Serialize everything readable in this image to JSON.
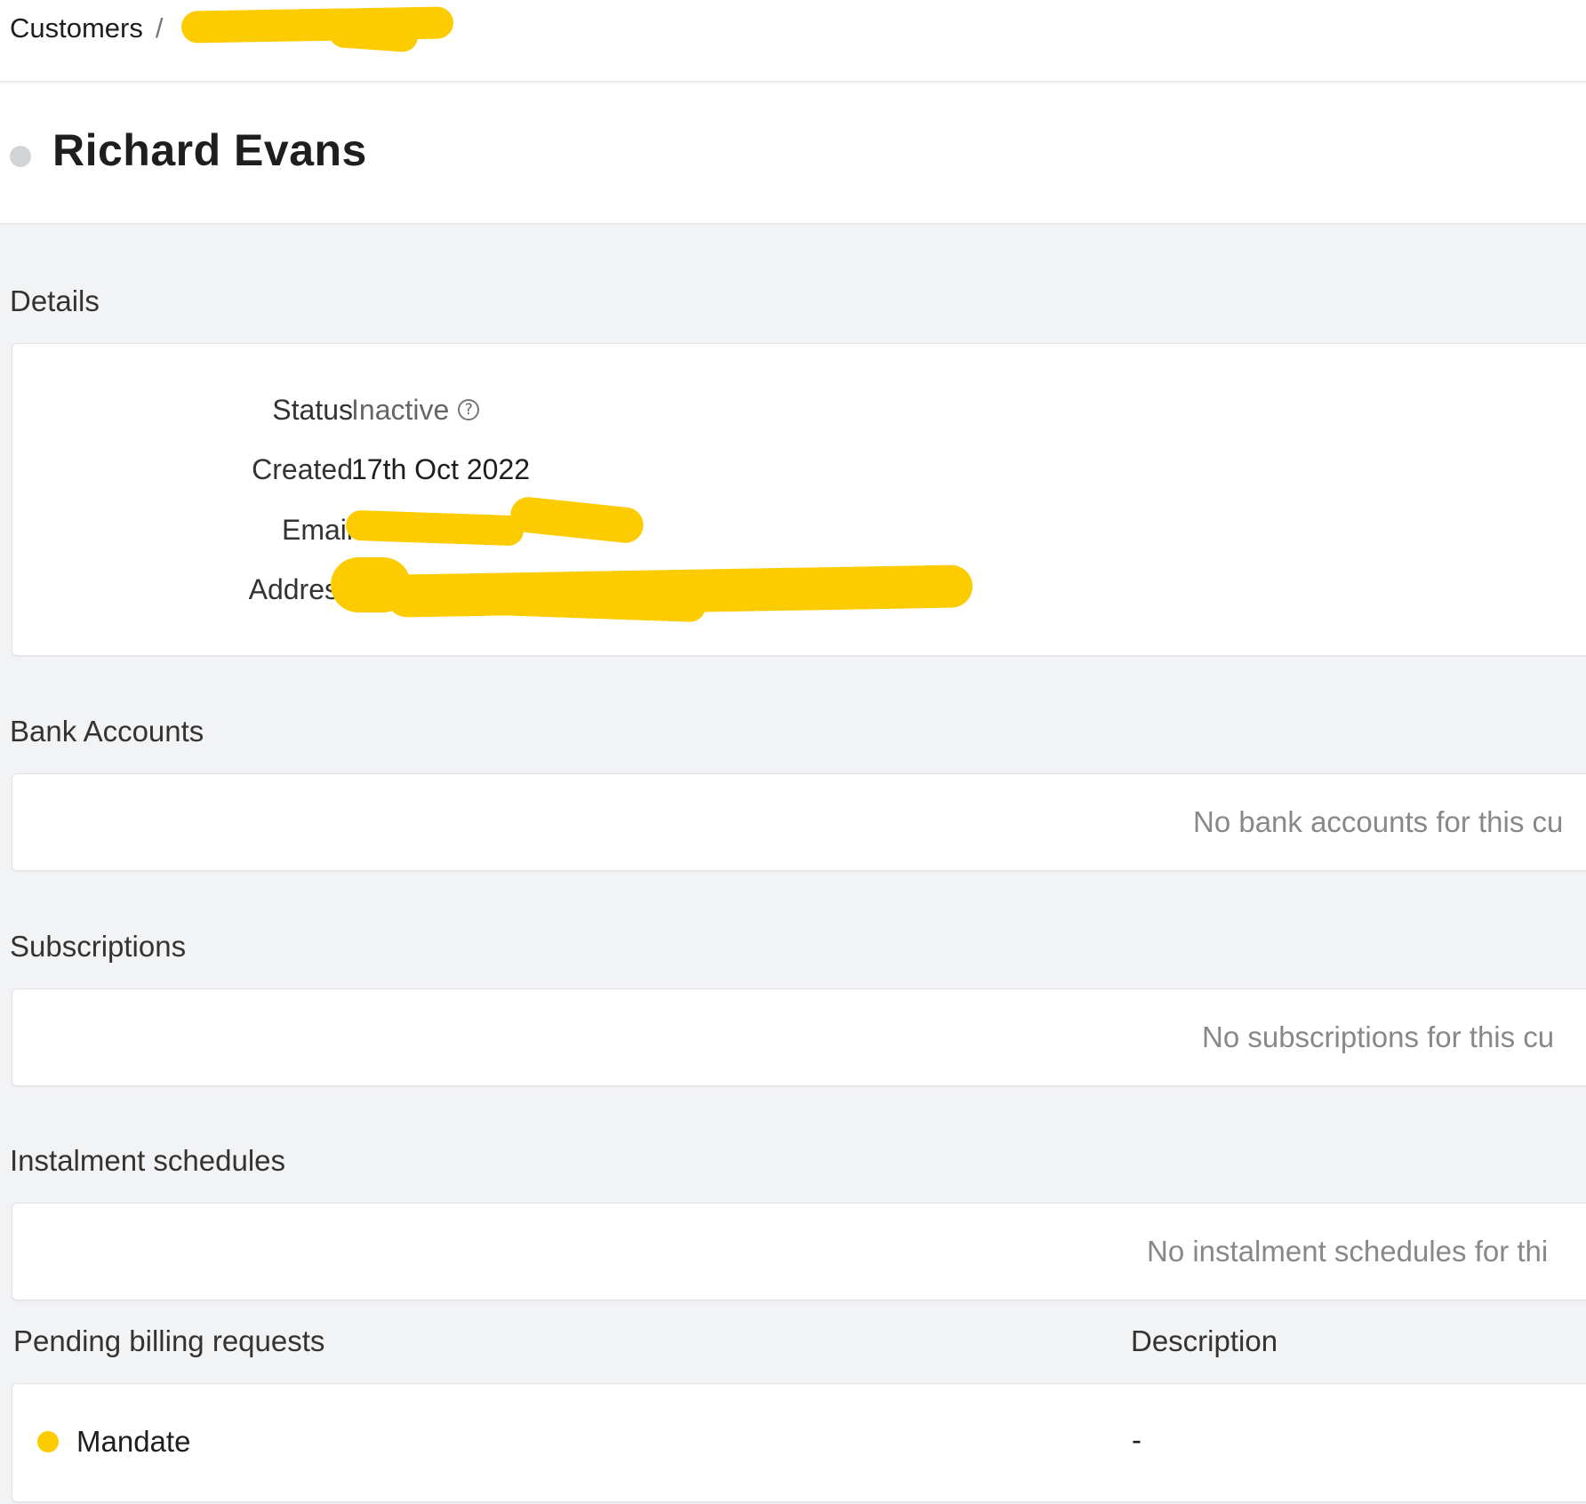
{
  "breadcrumb": {
    "root": "Customers",
    "separator": "/"
  },
  "customer": {
    "name": "Richard Evans",
    "status_dot_color": "#d2d4d8"
  },
  "details": {
    "title": "Details",
    "status_label": "Status",
    "status_value": "Inactive",
    "created_label": "Created",
    "created_value": "17th Oct 2022",
    "email_label": "Email",
    "address_label": "Address"
  },
  "bank_accounts": {
    "title": "Bank Accounts",
    "empty": "No bank accounts for this cu"
  },
  "subscriptions": {
    "title": "Subscriptions",
    "empty": "No subscriptions for this cu"
  },
  "instalment_schedules": {
    "title": "Instalment schedules",
    "empty": "No instalment schedules for thi"
  },
  "pending_billing_requests": {
    "title": "Pending billing requests",
    "description_header": "Description",
    "rows": [
      {
        "type": "Mandate",
        "description": "-",
        "status_color": "#fccc00"
      }
    ]
  },
  "colors": {
    "redaction": "#fccc00",
    "background": "#f2f3f5"
  }
}
